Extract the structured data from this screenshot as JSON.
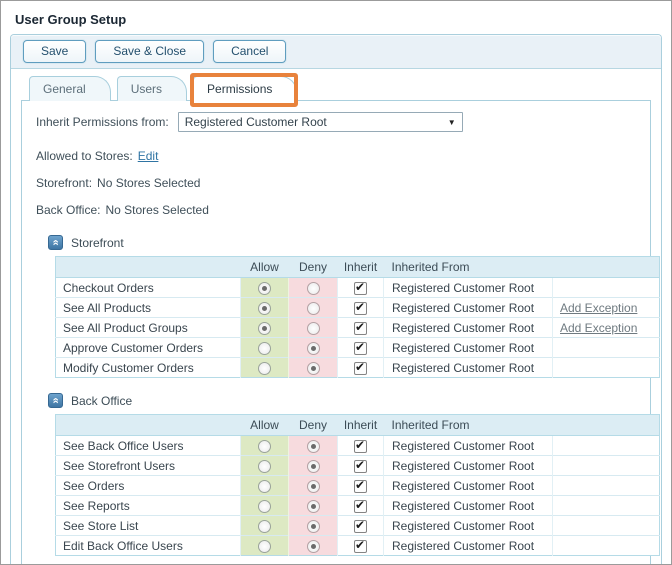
{
  "window": {
    "title": "User Group Setup"
  },
  "toolbar": {
    "buttons": [
      {
        "label": "Save"
      },
      {
        "label": "Save & Close"
      },
      {
        "label": "Cancel"
      }
    ]
  },
  "tabs": {
    "items": [
      {
        "label": "General",
        "active": false,
        "highlighted": false
      },
      {
        "label": "Users",
        "active": false,
        "highlighted": false
      },
      {
        "label": "Permissions",
        "active": true,
        "highlighted": true
      }
    ],
    "active_tab": "Permissions"
  },
  "form": {
    "inherit_from_label": "Inherit Permissions from:",
    "inherit_from_value": "Registered Customer Root",
    "allowed_to_stores_label": "Allowed to Stores:",
    "edit_link": "Edit",
    "storefront_label": "Storefront:",
    "storefront_value": "No Stores Selected",
    "back_office_label": "Back Office:",
    "back_office_value": "No Stores Selected"
  },
  "table_columns": {
    "allow": "Allow",
    "deny": "Deny",
    "inherit": "Inherit",
    "inherited_from": "Inherited From"
  },
  "sections": [
    {
      "title": "Storefront",
      "rows": [
        {
          "label": "Checkout Orders",
          "allow": true,
          "deny": false,
          "inherit": true,
          "inherited_from": "Registered Customer Root",
          "exception": ""
        },
        {
          "label": "See All Products",
          "allow": true,
          "deny": false,
          "inherit": true,
          "inherited_from": "Registered Customer Root",
          "exception": "Add Exception"
        },
        {
          "label": "See All Product Groups",
          "allow": true,
          "deny": false,
          "inherit": true,
          "inherited_from": "Registered Customer Root",
          "exception": "Add Exception"
        },
        {
          "label": "Approve Customer Orders",
          "allow": false,
          "deny": true,
          "inherit": true,
          "inherited_from": "Registered Customer Root",
          "exception": ""
        },
        {
          "label": "Modify Customer Orders",
          "allow": false,
          "deny": true,
          "inherit": true,
          "inherited_from": "Registered Customer Root",
          "exception": ""
        }
      ]
    },
    {
      "title": "Back Office",
      "rows": [
        {
          "label": "See Back Office Users",
          "allow": false,
          "deny": true,
          "inherit": true,
          "inherited_from": "Registered Customer Root",
          "exception": ""
        },
        {
          "label": "See Storefront Users",
          "allow": false,
          "deny": true,
          "inherit": true,
          "inherited_from": "Registered Customer Root",
          "exception": ""
        },
        {
          "label": "See Orders",
          "allow": false,
          "deny": true,
          "inherit": true,
          "inherited_from": "Registered Customer Root",
          "exception": ""
        },
        {
          "label": "See Reports",
          "allow": false,
          "deny": true,
          "inherit": true,
          "inherited_from": "Registered Customer Root",
          "exception": ""
        },
        {
          "label": "See Store List",
          "allow": false,
          "deny": true,
          "inherit": true,
          "inherited_from": "Registered Customer Root",
          "exception": ""
        },
        {
          "label": "Edit Back Office Users",
          "allow": false,
          "deny": true,
          "inherit": true,
          "inherited_from": "Registered Customer Root",
          "exception": ""
        }
      ]
    }
  ],
  "icons": {
    "collapse_glyph": "«",
    "dropdown_arrow": "▼",
    "check_glyph": "✔"
  },
  "colors": {
    "highlight_orange": "#E8823C",
    "panel_border_blue": "#AACFDD",
    "toolbar_bg": "#E9F1F7",
    "table_header_bg": "#DCEDF4",
    "allow_green": "#DDE9C3",
    "deny_pink": "#F7DBDE",
    "link_blue": "#2F74A3",
    "exception_link_gray": "#6F7A80",
    "outer_border_gray": "#9B9B9B"
  }
}
